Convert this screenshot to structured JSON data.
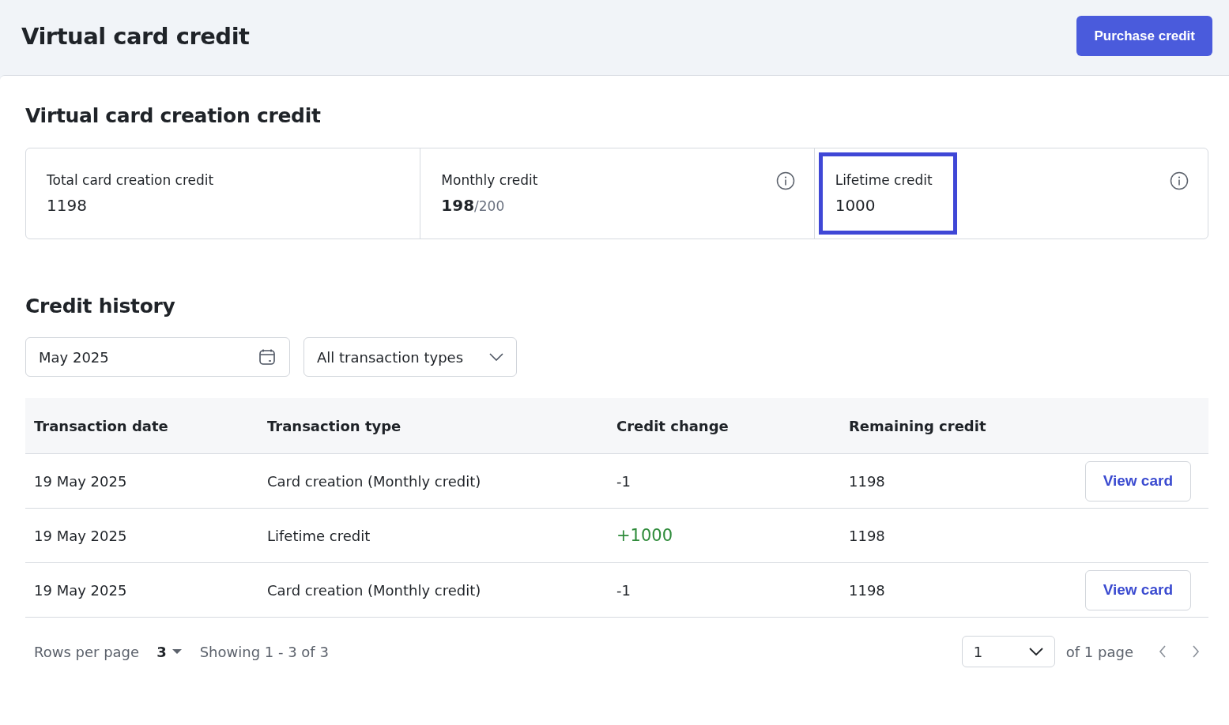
{
  "header": {
    "title": "Virtual card credit",
    "action": "Purchase credit"
  },
  "section": {
    "title": "Virtual card creation credit"
  },
  "stats": [
    {
      "label": "Total card creation credit",
      "value": "1198",
      "info": false,
      "highlighted": false
    },
    {
      "label": "Monthly credit",
      "value": "198",
      "limit": "/200",
      "info": true,
      "highlighted": false
    },
    {
      "label": "Lifetime credit",
      "value": "1000",
      "info": true,
      "highlighted": true
    }
  ],
  "history": {
    "title": "Credit history",
    "date_field": {
      "value": "May 2025"
    },
    "type_filter": {
      "value": "All transaction types"
    }
  },
  "table": {
    "columns": [
      "Transaction date",
      "Transaction type",
      "Credit change",
      "Remaining credit"
    ],
    "rows": [
      {
        "date": "19 May 2025",
        "type": "Card creation (Monthly credit)",
        "change": "-1",
        "color": "#1f2328",
        "remaining": "1198",
        "action": "View card"
      },
      {
        "date": "19 May 2025",
        "type": "Lifetime credit",
        "change": "+1000",
        "color": "#2e8b3a",
        "remaining": "1198"
      },
      {
        "date": "19 May 2025",
        "type": "Card creation (Monthly credit)",
        "change": "-1",
        "color": "#1f2328",
        "remaining": "1198",
        "action": "View card"
      }
    ]
  },
  "pagination": {
    "rows_label": "Rows per page",
    "rows_value": "3",
    "showing": "Showing 1 - 3 of 3",
    "page": "1",
    "of_pages": "of 1 page"
  }
}
